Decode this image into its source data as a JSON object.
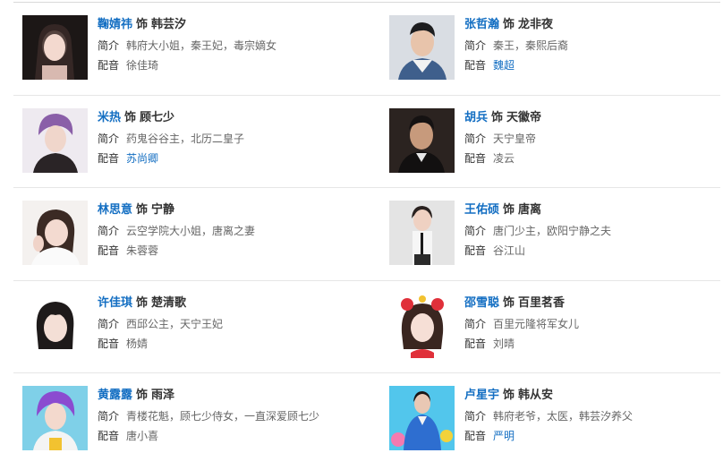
{
  "labels": {
    "connector": "饰",
    "intro": "简介",
    "dub": "配音"
  },
  "colors": {
    "link": "#136ec2",
    "text": "#333333",
    "muted": "#666666"
  },
  "cast": [
    {
      "actor": "鞠婧祎",
      "role": "韩芸汐",
      "intro": "韩府大小姐，秦王妃，毒宗嫡女",
      "dub": "徐佳琦",
      "dub_link": false
    },
    {
      "actor": "张哲瀚",
      "role": "龙非夜",
      "intro": "秦王，秦熙后裔",
      "dub": "魏超",
      "dub_link": true
    },
    {
      "actor": "米热",
      "role": "顾七少",
      "intro": "药鬼谷谷主，北历二皇子",
      "dub": "苏尚卿",
      "dub_link": true
    },
    {
      "actor": "胡兵",
      "role": "天徽帝",
      "intro": "天宁皇帝",
      "dub": "凌云",
      "dub_link": false
    },
    {
      "actor": "林思意",
      "role": "宁静",
      "intro": "云空学院大小姐，唐离之妻",
      "dub": "朱蓉蓉",
      "dub_link": false
    },
    {
      "actor": "王佑硕",
      "role": "唐离",
      "intro": "唐门少主，欧阳宁静之夫",
      "dub": "谷江山",
      "dub_link": false
    },
    {
      "actor": "许佳琪",
      "role": "楚清歌",
      "intro": "西邱公主，天宁王妃",
      "dub": "杨婧",
      "dub_link": false
    },
    {
      "actor": "邵雪聪",
      "role": "百里茗香",
      "intro": "百里元隆将军女儿",
      "dub": "刘晴",
      "dub_link": false
    },
    {
      "actor": "黄露露",
      "role": "雨泽",
      "intro": "青楼花魁，顾七少侍女，一直深爱顾七少",
      "dub": "唐小喜",
      "dub_link": false
    },
    {
      "actor": "卢星宇",
      "role": "韩从安",
      "intro": "韩府老爷，太医，韩芸汐养父",
      "dub": "严明",
      "dub_link": true
    }
  ]
}
